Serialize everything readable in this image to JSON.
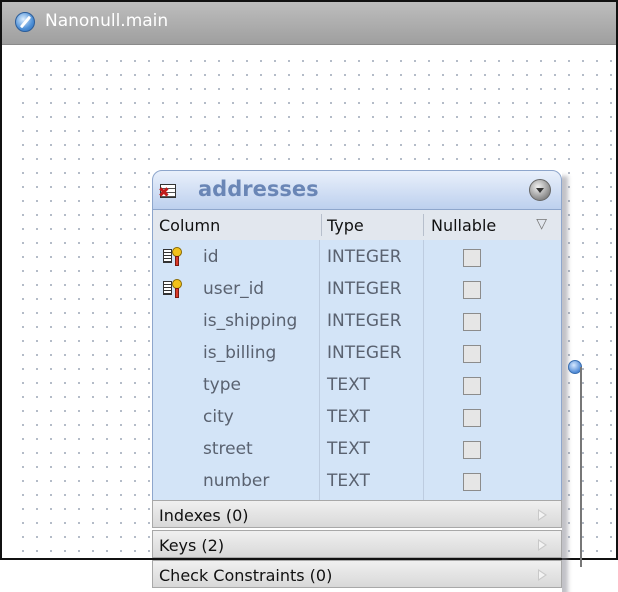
{
  "window": {
    "title": "Nanonull.main"
  },
  "table": {
    "name": "addresses",
    "headers": {
      "column": "Column",
      "type": "Type",
      "nullable": "Nullable"
    },
    "rows": [
      {
        "name": "id",
        "type": "INTEGER",
        "key": true
      },
      {
        "name": "user_id",
        "type": "INTEGER",
        "key": true
      },
      {
        "name": "is_shipping",
        "type": "INTEGER",
        "key": false
      },
      {
        "name": "is_billing",
        "type": "INTEGER",
        "key": false
      },
      {
        "name": "type",
        "type": "TEXT",
        "key": false
      },
      {
        "name": "city",
        "type": "TEXT",
        "key": false
      },
      {
        "name": "street",
        "type": "TEXT",
        "key": false
      },
      {
        "name": "number",
        "type": "TEXT",
        "key": false
      }
    ],
    "sections": {
      "indexes": "Indexes (0)",
      "keys": "Keys (2)",
      "checks": "Check Constraints (0)"
    }
  },
  "colors": {
    "title_text": "#6a86b6",
    "row_bg": "#d3e4f7",
    "header_bg": "#bdd0ee"
  }
}
